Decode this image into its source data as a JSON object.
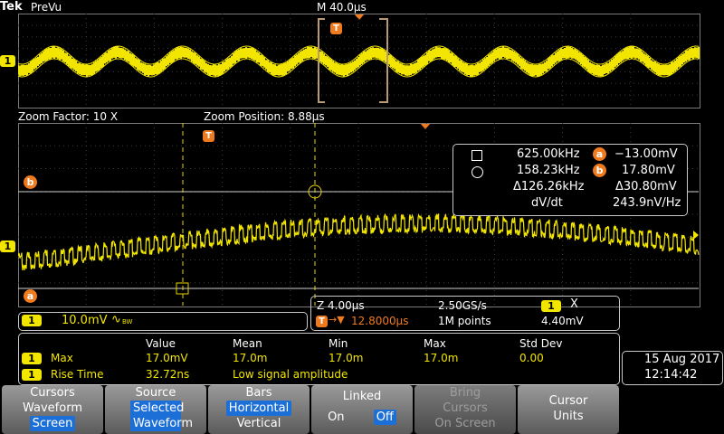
{
  "header": {
    "brand": "Tek",
    "mode": "PreVu",
    "horiz_scale": "M 40.0µs"
  },
  "zoom_info": {
    "factor": "Zoom Factor: 10 X",
    "position": "Zoom Position: 8.88µs"
  },
  "channel_badge": "1",
  "trigger_marker": "T",
  "cursor_labels": {
    "a": "a",
    "b": "b"
  },
  "cursor_readout": {
    "row1": {
      "freq": "625.00kHz",
      "cursor": "a",
      "value": "−13.00mV"
    },
    "row2": {
      "freq": "158.23kHz",
      "cursor": "b",
      "value": "17.80mV"
    },
    "row3": {
      "delta_freq": "Δ126.26kHz",
      "delta_v": "Δ30.80mV"
    },
    "row4": {
      "label": "dV/dt",
      "value": "243.9nV/Hz"
    }
  },
  "channel_info": {
    "scale": "10.0mV",
    "bw_symbol": "∿",
    "bw_sub": "BW"
  },
  "timebase": {
    "zoom_scale": "Z 4.00µs",
    "sample_rate": "2.50GS/s",
    "delay": "12.8000µs",
    "points": "1M points",
    "trigger_level": "4.40mV",
    "trigger_symbol": "X"
  },
  "measurements": {
    "headers": [
      "Value",
      "Mean",
      "Min",
      "Max",
      "Std Dev"
    ],
    "rows": [
      {
        "label": "Max",
        "values": [
          "17.0mV",
          "17.0m",
          "17.0m",
          "17.0m",
          "0.00"
        ]
      },
      {
        "label": "Rise Time",
        "values": [
          "32.72ns",
          "Low signal amplitude",
          "",
          "",
          ""
        ]
      }
    ]
  },
  "datetime": {
    "date": "15 Aug 2017",
    "time": "12:14:42"
  },
  "softkeys": [
    {
      "line1": "Cursors",
      "line2": "Waveform",
      "line3": "Screen"
    },
    {
      "line1": "Source",
      "line2": "Selected",
      "line3": "Waveform"
    },
    {
      "line1": "Bars",
      "line2": "Horizontal",
      "line3": "Vertical"
    },
    {
      "line1": "Linked",
      "on": "On",
      "off": "Off"
    },
    {
      "line1": "Bring",
      "line2": "Cursors",
      "line3": "On Screen"
    },
    {
      "line1": "Cursor",
      "line2": "Units"
    }
  ],
  "colors": {
    "trace": "#f2e600",
    "cursor_badge": "#f07a1e",
    "highlight": "#1d6fd8"
  }
}
